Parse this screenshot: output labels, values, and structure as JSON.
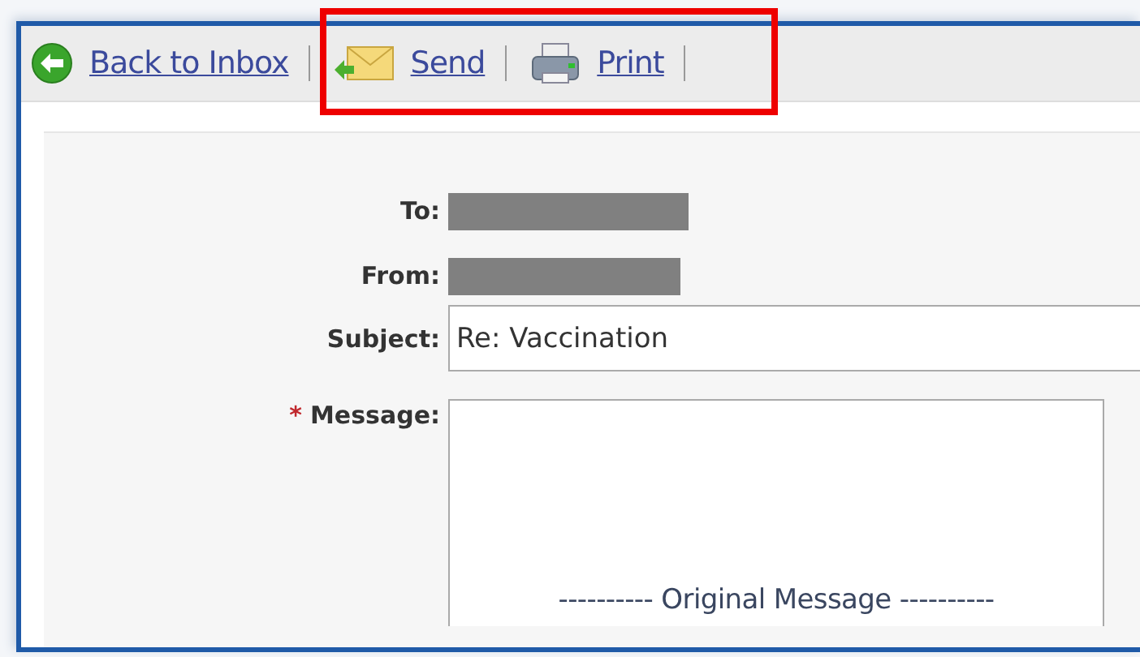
{
  "toolbar": [
    {
      "kind": "back",
      "label": "Back to Inbox"
    },
    {
      "kind": "send",
      "label": "Send"
    },
    {
      "kind": "print",
      "label": "Print"
    }
  ],
  "highlight": {
    "on": true
  },
  "form": {
    "to": {
      "label": "To:",
      "redacted": true
    },
    "from": {
      "label": "From:",
      "redacted": true
    },
    "subject": {
      "label": "Subject:",
      "value": "Re: Vaccination"
    },
    "message": {
      "label": "Message:",
      "required_mark": "*",
      "value": "---------- Original Message ----------"
    }
  }
}
